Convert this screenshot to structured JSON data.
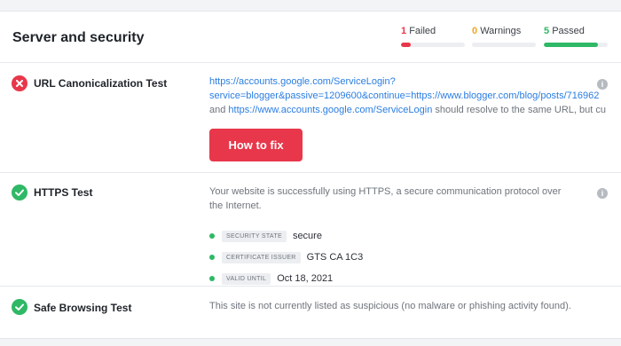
{
  "section": {
    "title": "Server and security"
  },
  "summary": {
    "failed": {
      "count": "1",
      "label": "Failed",
      "color": "#e8374a",
      "fraction": 0.15
    },
    "warnings": {
      "count": "0",
      "label": "Warnings",
      "color": "#f2a51f",
      "fraction": 0
    },
    "passed": {
      "count": "5",
      "label": "Passed",
      "color": "#2fb866",
      "fraction": 0.85
    }
  },
  "tests": [
    {
      "name": "URL Canonicalization Test",
      "status": "failed",
      "status_icon": "x-circle-icon",
      "description_line1_link": "https://accounts.google.com/ServiceLogin?",
      "description_line2_link": "service=blogger&passive=1209600&continue=https://www.blogger.com/blog/posts/716962",
      "description_line3_prefix": "and ",
      "description_line3_link": "https://www.accounts.google.com/ServiceLogin",
      "description_line3_suffix": " should resolve to the same URL, but cu",
      "action_label": "How to fix"
    },
    {
      "name": "HTTPS Test",
      "status": "passed",
      "status_icon": "check-circle-icon",
      "description": "Your website is successfully using HTTPS, a secure communication protocol over the Internet.",
      "details": [
        {
          "key": "Security State",
          "value": "secure"
        },
        {
          "key": "Certificate Issuer",
          "value": "GTS CA 1C3"
        },
        {
          "key": "Valid Until",
          "value": "Oct 18, 2021"
        }
      ]
    },
    {
      "name": "Safe Browsing Test",
      "status": "passed",
      "status_icon": "check-circle-icon",
      "description": "This site is not currently listed as suspicious (no malware or phishing activity found)."
    }
  ],
  "colors": {
    "fail": "#e8374a",
    "pass": "#2fb866",
    "link": "#2a7de1"
  }
}
